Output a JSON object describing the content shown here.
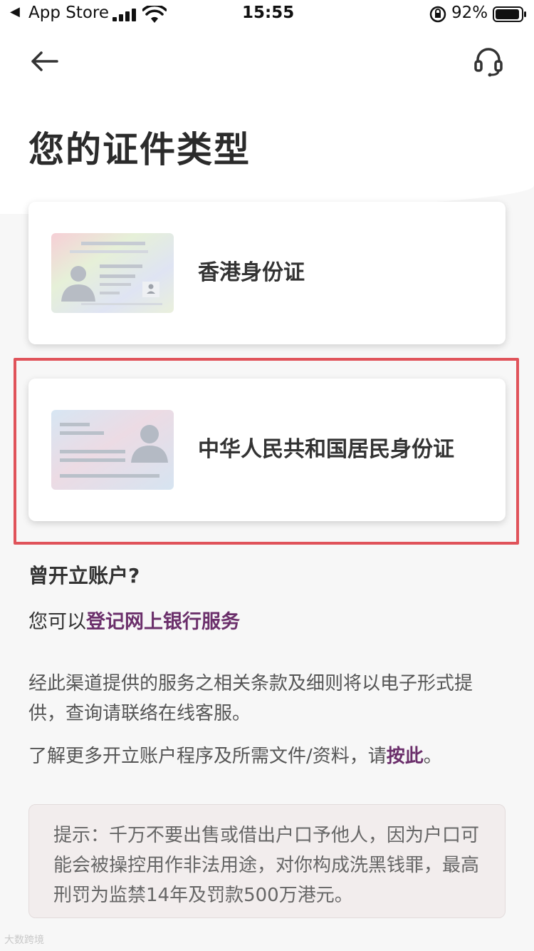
{
  "status_bar": {
    "back_label": "App Store",
    "time": "15:55",
    "battery_pct": "92%"
  },
  "nav": {
    "back_icon": "arrow-left-icon",
    "help_icon": "headset-icon"
  },
  "page": {
    "title": "您的证件类型"
  },
  "cards": [
    {
      "label": "香港身份证",
      "icon": "hk-id-card-icon"
    },
    {
      "label": "中华人民共和国居民身份证",
      "icon": "prc-id-card-icon",
      "highlighted": true
    }
  ],
  "existing_account": {
    "title": "曾开立账户?",
    "prefix": "您可以",
    "link": "登记网上银行服务"
  },
  "terms_text": "经此渠道提供的服务之相关条款及细则将以电子形式提供，查询请联络在线客服。",
  "more_info": {
    "prefix": "了解更多开立账户程序及所需文件/资料，请",
    "link": "按此",
    "suffix": "。"
  },
  "tip": "提示：千万不要出售或借出户口予他人，因为户口可能会被操控用作非法用途，对你构成洗黑钱罪，最高刑罚为监禁14年及罚款500万港元。",
  "watermark": "大数跨境",
  "colors": {
    "accent_link": "#6b2f6b",
    "highlight_border": "#e0535a",
    "tip_bg": "#f2eded"
  }
}
